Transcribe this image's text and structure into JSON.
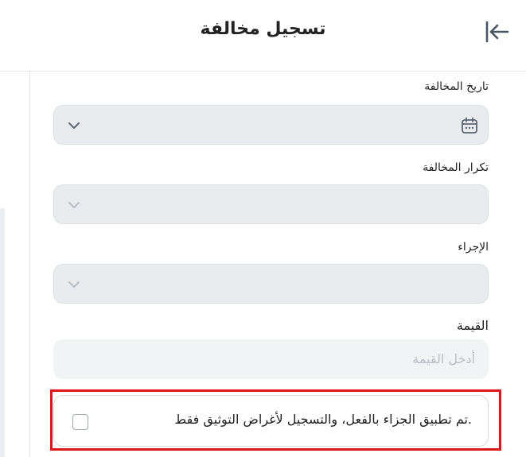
{
  "header": {
    "title": "تسجيل مخالفة",
    "back_icon": "arrow-left-to-line-icon"
  },
  "form": {
    "violation_date": {
      "label": "تاريخ المخالفة",
      "icon": "calendar-icon"
    },
    "violation_repetition": {
      "label": "تكرار المخالفة"
    },
    "action": {
      "label": "الإجراء"
    },
    "value": {
      "label": "القيمة",
      "placeholder": "أدخل القيمة"
    },
    "penalty_applied_checkbox": {
      "label": ".تم تطبيق الجزاء بالفعل، والتسجيل لأغراض التوثيق فقط",
      "checked": false
    }
  },
  "colors": {
    "highlight_border": "#e0141b",
    "field_disabled_bg": "#e9ebee",
    "icon_color": "#5b6470"
  }
}
